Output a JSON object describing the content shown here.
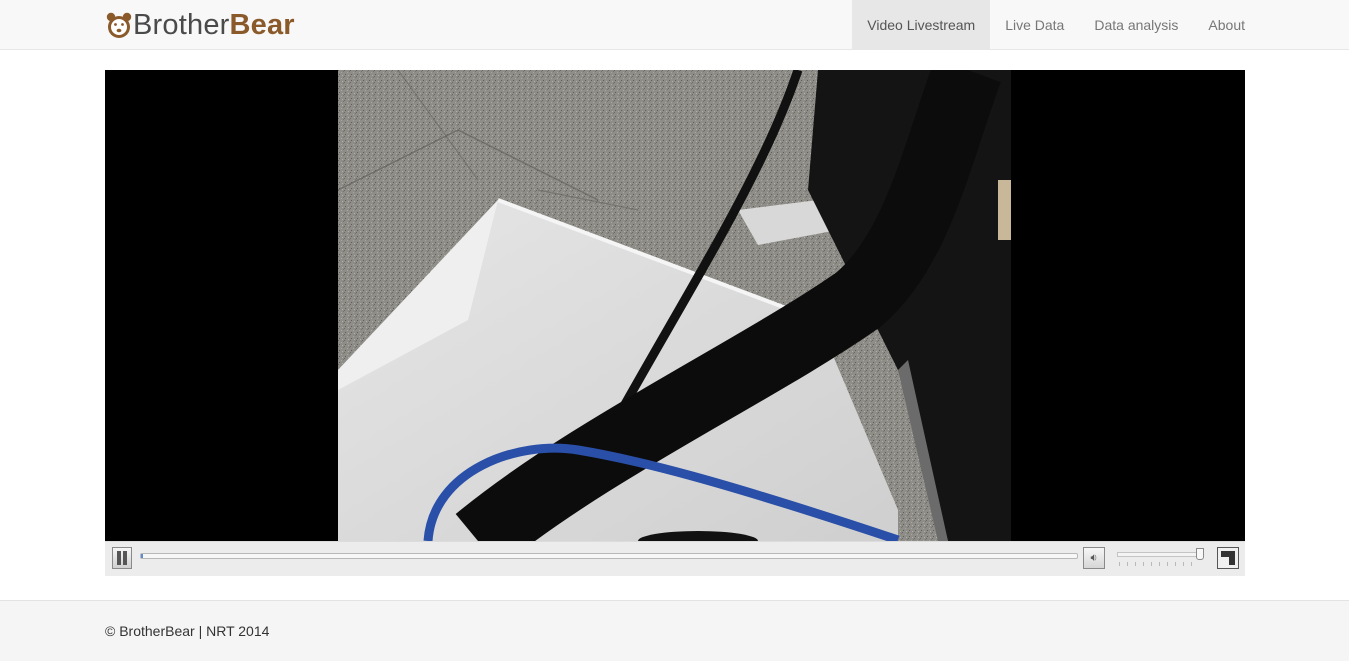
{
  "brand": {
    "name_light": "Brother",
    "name_bold": "Bear",
    "logo_icon": "bear-face-icon",
    "accent_color": "#8b5a2b"
  },
  "nav": {
    "items": [
      {
        "label": "Video Livestream",
        "active": true
      },
      {
        "label": "Live Data",
        "active": false
      },
      {
        "label": "Data analysis",
        "active": false
      },
      {
        "label": "About",
        "active": false
      }
    ]
  },
  "player": {
    "state": "playing",
    "progress": 0.002,
    "volume": 0.98,
    "controls": {
      "pause_icon": "pause-icon",
      "mute_icon": "speaker-icon",
      "fullscreen_icon": "fullscreen-icon"
    }
  },
  "footer": {
    "text": "© BrotherBear | NRT 2014"
  }
}
